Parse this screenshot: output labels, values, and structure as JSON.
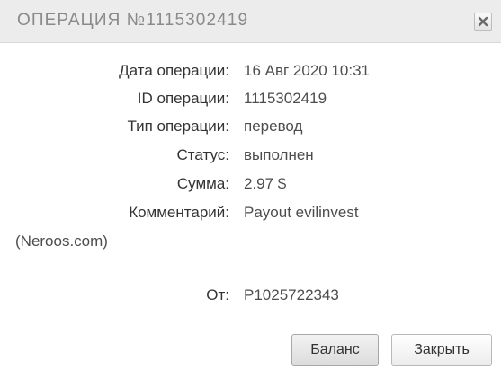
{
  "dialog": {
    "title": "ОПЕРАЦИЯ №1115302419",
    "close_icon": "close-x-icon"
  },
  "fields": {
    "date": {
      "label": "Дата операции:",
      "value": "16 Авг 2020 10:31"
    },
    "id": {
      "label": "ID операции:",
      "value": "1115302419"
    },
    "type": {
      "label": "Тип операции:",
      "value": "перевод"
    },
    "status": {
      "label": "Статус:",
      "value": "выполнен"
    },
    "amount": {
      "label": "Сумма:",
      "value": "2.97 $"
    },
    "comment": {
      "label": "Комментарий:",
      "value": "Payout evilinvest",
      "value_cont": "(Neroos.com)"
    },
    "from": {
      "label": "От:",
      "value": "P1025722343"
    }
  },
  "buttons": {
    "balance": "Баланс",
    "close": "Закрыть"
  }
}
